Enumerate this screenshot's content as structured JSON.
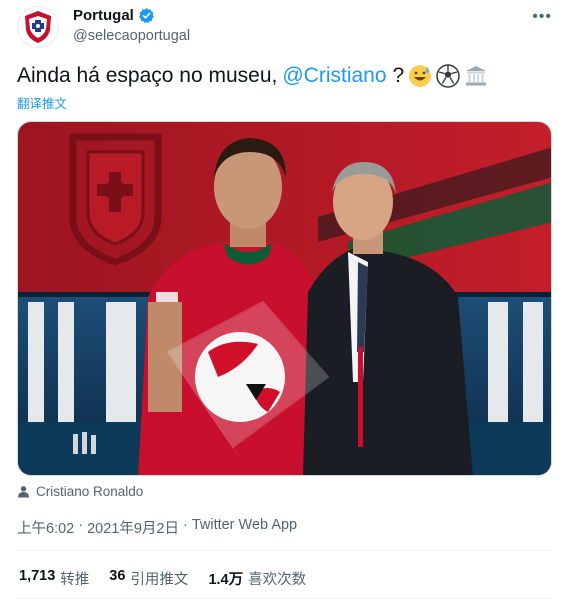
{
  "account": {
    "name": "Portugal",
    "handle": "@selecaoportugal",
    "verified_color": "#1d9bf0"
  },
  "tweet": {
    "text": "Ainda há espaço no museu,",
    "mention": "@Cristiano",
    "punct": "?",
    "emojis": [
      "grinning-sweat-emoji",
      "soccer-ball-emoji",
      "classical-building-emoji"
    ],
    "translate_label": "翻译推文"
  },
  "media": {
    "tagged_person": "Cristiano Ronaldo"
  },
  "meta": {
    "time": "上午6:02",
    "separator1": "·",
    "date": "2021年9月2日",
    "separator2": "·",
    "source": "Twitter Web App"
  },
  "stats": [
    {
      "count": "1,713",
      "label": "转推"
    },
    {
      "count": "36",
      "label": "引用推文"
    },
    {
      "count": "1.4万",
      "label": "喜欢次数"
    }
  ],
  "colors": {
    "accent": "#1d9bf0",
    "text": "#0f1419",
    "muted": "#536471",
    "crest_red": "#c8102e"
  }
}
